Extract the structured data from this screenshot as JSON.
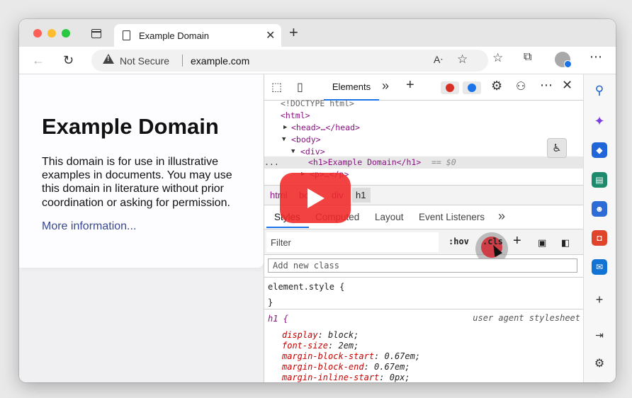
{
  "browser": {
    "tab_title": "Example Domain",
    "tab_close": "✕",
    "new_tab": "+",
    "security_label": "Not Secure",
    "url": "example.com"
  },
  "webpage": {
    "heading": "Example Domain",
    "paragraph": "This domain is for use in illustrative examples in documents. You may use this domain in literature without prior coordination or asking for permission.",
    "link": "More information..."
  },
  "devtools": {
    "active_tab": "Elements",
    "dom": [
      "<!DOCTYPE html>",
      "<html>",
      "<head>…</head>",
      "<body>",
      "<div>",
      "<h1>Example Domain</h1>",
      "== $0",
      "<p>…</p>",
      "..."
    ],
    "breadcrumbs": [
      "html",
      "body",
      "div",
      "h1"
    ],
    "style_tabs": [
      "Styles",
      "Computed",
      "Layout",
      "Event Listeners"
    ],
    "filter_placeholder": "Filter",
    "hov": ":hov",
    "cls": ".cls",
    "add_class_placeholder": "Add new class",
    "element_style_open": "element.style {",
    "element_style_close": "}",
    "rule_selector": "h1 {",
    "rule_source": "user agent stylesheet",
    "declarations": [
      {
        "prop": "display",
        "value": "block;"
      },
      {
        "prop": "font-size",
        "value": "2em;"
      },
      {
        "prop": "margin-block-start",
        "value": "0.67em;"
      },
      {
        "prop": "margin-block-end",
        "value": "0.67em;"
      },
      {
        "prop": "margin-inline-start",
        "value": "0px;"
      }
    ]
  },
  "colors": {
    "accent": "#1a73e8",
    "tag": "#881280",
    "error": "#d93025"
  }
}
